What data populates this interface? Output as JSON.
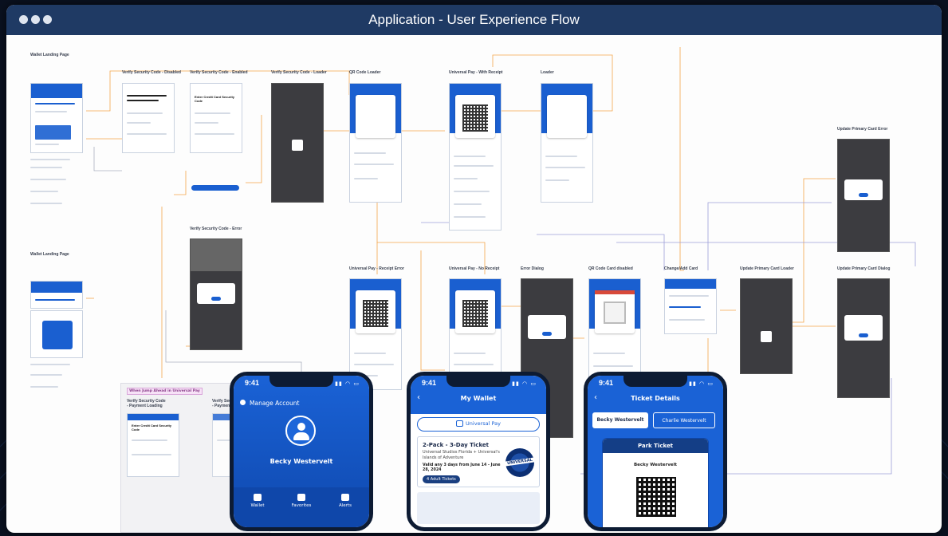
{
  "window": {
    "title": "Application - User Experience Flow",
    "dots": [
      "#dfe5ef",
      "#dfe5ef",
      "#dfe5ef"
    ]
  },
  "colors": {
    "titlebar": "#1f3a64",
    "accent": "#1a5fd0",
    "flow_orange": "#f3a54a",
    "flow_purple": "#9d9ed8"
  },
  "labels": {
    "wallet_landing_1": "Wallet Landing Page",
    "wallet_landing_2": "Wallet Landing Page",
    "verify_disabled": "Verify Security Code - Disabled",
    "verify_enabled": "Verify Security Code - Enabled",
    "verify_loader": "Verify Security Code - Loader",
    "qr_loader": "QR Code Loader",
    "universal_pay_receipt": "Universal Pay - With Receipt",
    "loader": "Loader",
    "update_primary_error": "Update Primary Card Error",
    "verify_error": "Verify Security Code - Error",
    "universal_pay_receipt_error": "Universal Pay - Receipt Error",
    "universal_pay_no_receipt": "Universal Pay - No Receipt",
    "error_dialog": "Error Dialog",
    "qr_card_disabled": "QR Code Card disabled",
    "change_add_card": "Change/Add Card",
    "update_primary_loader": "Update Primary Card Loader",
    "update_primary_dialog": "Update Primary Card Dialog",
    "verify_payment_loading_1": "Verify Security Code\n- Payment Loading",
    "verify_payment_loading_2": "Verify Security Code\n- Payment Loading",
    "pink_banner": "When Jump Ahead in Universal Pay",
    "enter_code_title": "Enter Credit Card Security Code"
  },
  "phones": {
    "profile": {
      "time": "9:41",
      "manage_account": "Manage Account",
      "user_name": "Becky Westervelt",
      "tabs": [
        "Wallet",
        "Favorites",
        "Alerts"
      ]
    },
    "wallet": {
      "time": "9:41",
      "title": "My Wallet",
      "universal_pay": "Universal Pay",
      "ticket_title": "2-Pack - 3-Day Ticket",
      "ticket_sub": "Universal Studios Florida + Universal's Islands of Adventure",
      "ticket_valid": "Valid any 3 days from June 14 - June 28, 2024",
      "ticket_badge": "4 Adult Tickets",
      "logo_text": "UNIVERSAL"
    },
    "ticket_details": {
      "time": "9:41",
      "title": "Ticket Details",
      "tab_active": "Becky Westervelt",
      "tab_inactive": "Charlie Westervelt",
      "card_header": "Park Ticket",
      "card_name": "Becky Westervelt"
    }
  }
}
